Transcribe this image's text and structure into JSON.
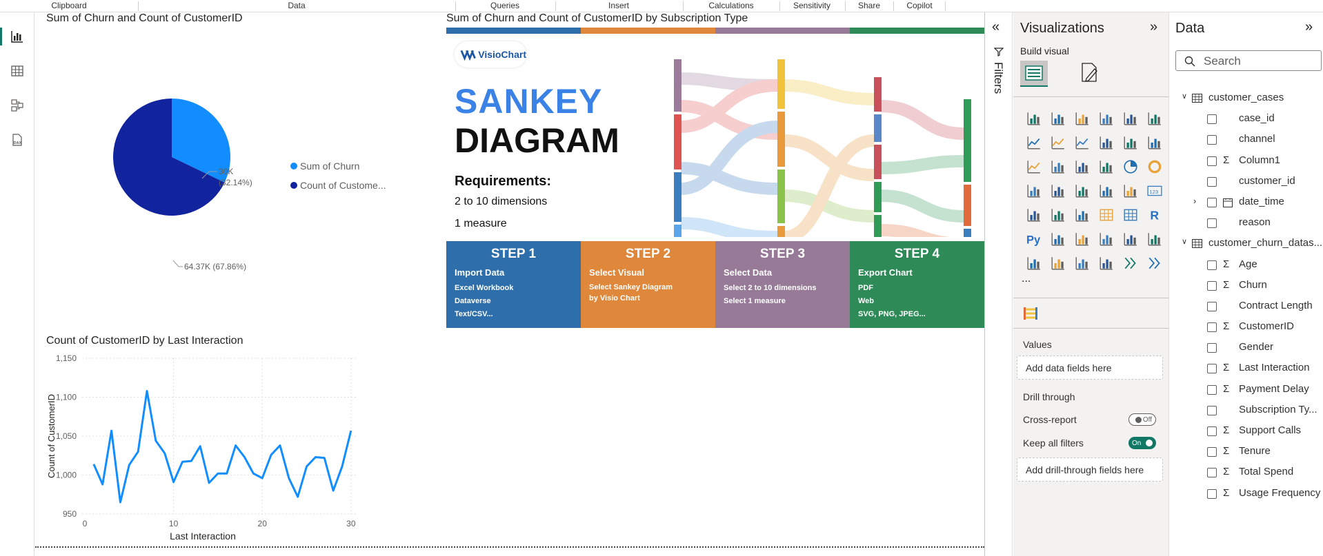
{
  "ribbon": [
    "Clipboard",
    "Data",
    "Queries",
    "Insert",
    "Calculations",
    "Sensitivity",
    "Share",
    "Copilot"
  ],
  "pie": {
    "title": "Sum of Churn and Count of CustomerID",
    "slices": [
      {
        "name": "Sum of Churn",
        "label": "30K",
        "pct": "(32.14%)",
        "value": 32.14,
        "color": "#118dff"
      },
      {
        "name": "Count of Custome...",
        "label": "64.37K (67.86%)",
        "value": 67.86,
        "color": "#12239e"
      }
    ]
  },
  "chart_data": {
    "type": "line",
    "title": "Count of CustomerID by Last Interaction",
    "xlabel": "Last Interaction",
    "ylabel": "Count of CustomerID",
    "x": [
      1,
      2,
      3,
      4,
      5,
      6,
      7,
      8,
      9,
      10,
      11,
      12,
      13,
      14,
      15,
      16,
      17,
      18,
      19,
      20,
      21,
      22,
      23,
      24,
      25,
      26,
      27,
      28,
      29,
      30
    ],
    "values": [
      1014,
      988,
      1057,
      965,
      1013,
      1030,
      1108,
      1044,
      1028,
      991,
      1017,
      1018,
      1037,
      990,
      1002,
      1002,
      1038,
      1023,
      1002,
      996,
      1026,
      1038,
      996,
      972,
      1011,
      1023,
      1022,
      980,
      1011,
      1057
    ],
    "ylim": [
      950,
      1150
    ],
    "yticks": [
      "1,150",
      "1,100",
      "1,050",
      "1,000",
      "950"
    ],
    "xticks": [
      "0",
      "10",
      "20",
      "30"
    ],
    "color": "#118dff"
  },
  "visio": {
    "title": "Sum of Churn and Count of CustomerID by Subscription Type",
    "logo": "VisioChart",
    "h1": "SANKEY",
    "h2": "DIAGRAM",
    "req_title": "Requirements:",
    "req1": "2 to 10 dimensions",
    "req2": "1 measure",
    "steps": [
      {
        "title": "STEP 1",
        "sub": "Import Data",
        "lines": [
          "Excel Workbook",
          "Dataverse",
          "Text/CSV..."
        ],
        "color": "#2e6fab"
      },
      {
        "title": "STEP 2",
        "sub": "Select Visual",
        "lines": [
          "Select Sankey Diagram",
          "by Visio Chart"
        ],
        "color": "#df873a"
      },
      {
        "title": "STEP 3",
        "sub": "Select Data",
        "lines": [
          "Select 2 to 10 dimensions",
          "Select 1 measure"
        ],
        "color": "#977a97"
      },
      {
        "title": "STEP 4",
        "sub": "Export Chart",
        "lines": [
          "PDF",
          "Web",
          "SVG, PNG, JPEG..."
        ],
        "color": "#2e8b57"
      }
    ]
  },
  "filters": {
    "label": "Filters"
  },
  "viz": {
    "title": "Visualizations",
    "build": "Build visual",
    "more": "...",
    "values": "Values",
    "values_well": "Add data fields here",
    "drill": "Drill through",
    "cross": "Cross-report",
    "cross_state": "Off",
    "keep": "Keep all filters",
    "keep_state": "On",
    "drill_well": "Add drill-through fields here"
  },
  "data": {
    "title": "Data",
    "search_placeholder": "Search",
    "tables": [
      {
        "name": "customer_cases",
        "fields": [
          {
            "n": "case_id",
            "s": false
          },
          {
            "n": "channel",
            "s": false
          },
          {
            "n": "Column1",
            "s": true
          },
          {
            "n": "customer_id",
            "s": false
          },
          {
            "n": "date_time",
            "s": false,
            "cal": true
          },
          {
            "n": "reason",
            "s": false
          }
        ]
      },
      {
        "name": "customer_churn_datas...",
        "fields": [
          {
            "n": "Age",
            "s": true
          },
          {
            "n": "Churn",
            "s": true
          },
          {
            "n": "Contract Length",
            "s": false
          },
          {
            "n": "CustomerID",
            "s": true
          },
          {
            "n": "Gender",
            "s": false
          },
          {
            "n": "Last Interaction",
            "s": true
          },
          {
            "n": "Payment Delay",
            "s": true
          },
          {
            "n": "Subscription Ty...",
            "s": false
          },
          {
            "n": "Support Calls",
            "s": true
          },
          {
            "n": "Tenure",
            "s": true
          },
          {
            "n": "Total Spend",
            "s": true
          },
          {
            "n": "Usage Frequency",
            "s": true
          }
        ]
      }
    ]
  }
}
